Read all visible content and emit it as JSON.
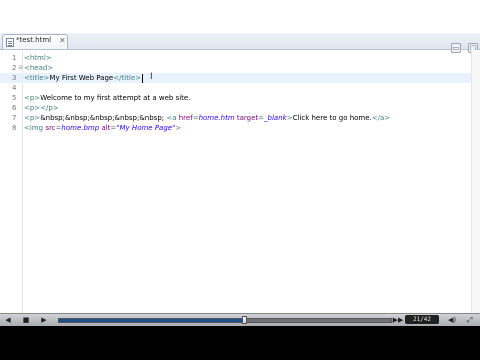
{
  "tab": {
    "label": "*test.html",
    "close": "✕"
  },
  "window_buttons": [
    "▭",
    "▢"
  ],
  "lines": [
    {
      "num": "1",
      "fold": "",
      "current": false,
      "parts": [
        {
          "t": "tag",
          "v": "<html>"
        }
      ]
    },
    {
      "num": "2",
      "fold": "⊖",
      "current": false,
      "parts": [
        {
          "t": "tag",
          "v": "<head>"
        }
      ]
    },
    {
      "num": "3",
      "fold": "",
      "current": true,
      "caret": true,
      "parts": [
        {
          "t": "tag",
          "v": "<title>"
        },
        {
          "t": "txt",
          "v": "My First Web Page"
        },
        {
          "t": "tag",
          "v": "</title>"
        }
      ]
    },
    {
      "num": "4",
      "fold": "",
      "current": false,
      "parts": []
    },
    {
      "num": "5",
      "fold": "",
      "current": false,
      "parts": [
        {
          "t": "tag",
          "v": "<p>"
        },
        {
          "t": "txt",
          "v": "Welcome to my first attempt at a web site."
        }
      ]
    },
    {
      "num": "6",
      "fold": "",
      "current": false,
      "parts": [
        {
          "t": "tag",
          "v": "<p>"
        },
        {
          "t": "tag",
          "v": "</p>"
        }
      ]
    },
    {
      "num": "7",
      "fold": "",
      "current": false,
      "parts": [
        {
          "t": "tag",
          "v": "<p>"
        },
        {
          "t": "txt",
          "v": "&nbsp;&nbsp;&nbsp;&nbsp;&nbsp; "
        },
        {
          "t": "tag",
          "v": "<a "
        },
        {
          "t": "attr",
          "v": "href"
        },
        {
          "t": "tag",
          "v": "="
        },
        {
          "t": "val",
          "v": "home.htm"
        },
        {
          "t": "tag",
          "v": " "
        },
        {
          "t": "attr",
          "v": "target"
        },
        {
          "t": "tag",
          "v": "="
        },
        {
          "t": "val",
          "v": "_blank"
        },
        {
          "t": "tag",
          "v": ">"
        },
        {
          "t": "txt",
          "v": "Click here to go home."
        },
        {
          "t": "tag",
          "v": "</a>"
        }
      ]
    },
    {
      "num": "8",
      "fold": "",
      "current": false,
      "parts": [
        {
          "t": "tag",
          "v": "<img "
        },
        {
          "t": "attr",
          "v": "src"
        },
        {
          "t": "tag",
          "v": "="
        },
        {
          "t": "val",
          "v": "home.bmp"
        },
        {
          "t": "tag",
          "v": " "
        },
        {
          "t": "attr",
          "v": "alt"
        },
        {
          "t": "tag",
          "v": "="
        },
        {
          "t": "val",
          "v": "\"My Home Page\""
        },
        {
          "t": "tag",
          "v": ">"
        }
      ]
    }
  ],
  "player": {
    "progress": 0.56,
    "counter": "21/42",
    "buttons": {
      "prev": "◀",
      "stop": "■",
      "play": "▶",
      "next": "▶▶",
      "volume": "◀)",
      "fullscreen": "⤢"
    }
  }
}
